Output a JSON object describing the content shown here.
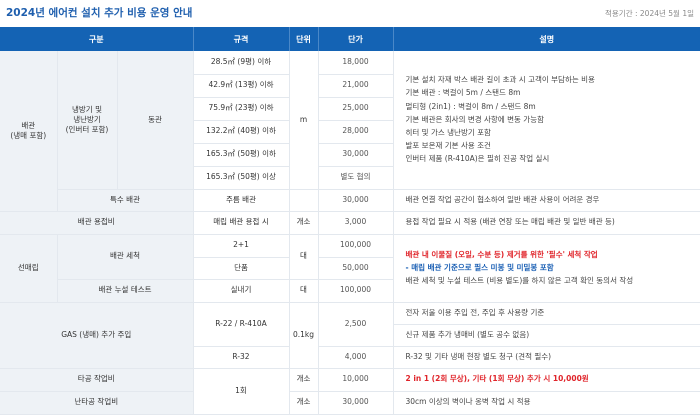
{
  "title": "2024년 에어컨 설치 추가 비용 운영 안내",
  "period": "적용기간 : 2024년 5월 1일",
  "headers": {
    "c1": "구분",
    "c2": "규격",
    "c3": "단위",
    "c4": "단가",
    "c5": "설명"
  },
  "pipe": {
    "label1": "배관",
    "label2": "(냉매 포함)",
    "cool1": "냉방기 및",
    "cool2": "냉난방기",
    "cool3": "(인버터 포함)",
    "copper": "동관",
    "special": "특수 배관",
    "unit": "m",
    "rows": [
      {
        "spec": "28.5㎡ (9평) 이하",
        "price": "18,000"
      },
      {
        "spec": "42.9㎡ (13평) 이하",
        "price": "21,000"
      },
      {
        "spec": "75.9㎡ (23평) 이하",
        "price": "25,000"
      },
      {
        "spec": "132.2㎡ (40평) 이하",
        "price": "28,000"
      },
      {
        "spec": "165.3㎡ (50평) 이하",
        "price": "30,000"
      },
      {
        "spec": "165.3㎡ (50평) 이상",
        "price": "별도 협의"
      }
    ],
    "desc": [
      "기본 설치 자재 박스 배관 길이 초과 시 고객이 부담하는 비용",
      "기본 배관 : 벽걸이 5m / 스탠드 8m",
      "멀티형 (2in1) : 벽걸이 8m / 스탠드 8m",
      "기본 배관은 회사의 변경 사항에 변동 가능함",
      "히터 및 가스 냉난방기 포함",
      "발포 보온재 기본 사용 조건",
      "인버터 제품 (R-410A)은 필히 진공 작업 실시"
    ],
    "special_spec": "주름 배관",
    "special_price": "30,000",
    "special_desc": "배관 연결 작업 공간이 협소하여 일반 배관 사용이 어려운 경우"
  },
  "weld": {
    "label": "배관 용접비",
    "spec": "매립 배관 용접 시",
    "unit": "개소",
    "price": "3,000",
    "desc": "용접 작업 필요 시 적용 (배관 연장 또는 매립 배관 및 일반 배관 등)"
  },
  "buried": {
    "label": "선매립",
    "clean": "배관 세척",
    "unit": "대",
    "rows": [
      {
        "spec": "2+1",
        "price": "100,000"
      },
      {
        "spec": "단품",
        "price": "50,000"
      }
    ],
    "desc_red": "배관 내 이물질 (오일, 수분 등) 제거를 위한 '필수' 세척 작업",
    "desc_blue": "- 매립 배관 기준으로 필스 미봉 및 미밀봉 포함",
    "desc3": "배관 세척 및 누설 테스트 (비용 별도)를 하지 않은 고객 확인 동의서 작성",
    "leak": "배관 누설 테스트",
    "leak_spec": "실내기",
    "leak_unit": "대",
    "leak_price": "100,000"
  },
  "gas": {
    "label": "GAS (냉매) 추가 주입",
    "unit": "0.1kg",
    "rows": [
      {
        "spec": "R-22 / R-410A",
        "price": "2,500",
        "desc": "전자 저울 이용 주입 전, 주입 후 사용량 기준"
      },
      {
        "spec": "",
        "price": "",
        "desc": "신규 제품 추가 냉매비 (별도 공수 없음)"
      },
      {
        "spec": "R-32",
        "price": "4,000",
        "desc": "R-32 및 기타 냉매 현장 별도 청구 (견적 필수)"
      }
    ]
  },
  "tagong": {
    "label": "타공 작업비",
    "spec": "1회",
    "unit": "개소",
    "price": "10,000",
    "desc": "2 in 1 (2회 무상), 기타 (1회 무상) 추가 시 10,000원"
  },
  "nantagong": {
    "label": "난타공 작업비",
    "unit": "개소",
    "price": "30,000",
    "desc": "30cm 이상의 벽이나 옹벽 작업 시 적용"
  }
}
